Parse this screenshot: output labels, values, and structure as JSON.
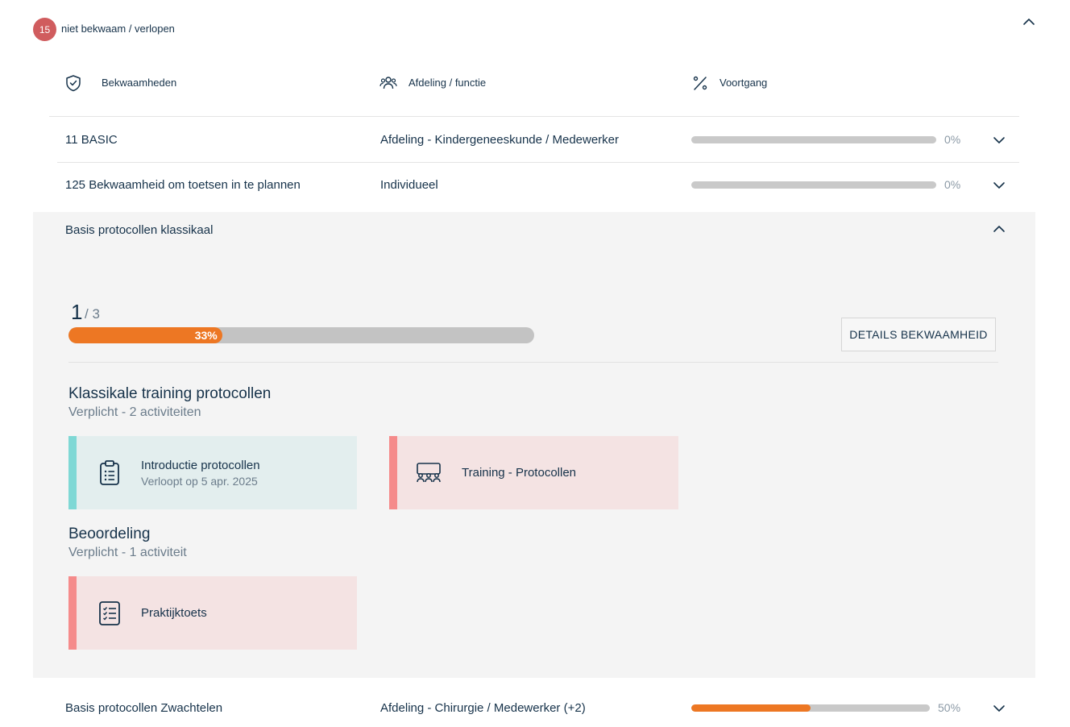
{
  "header": {
    "badge_count": "15",
    "badge_label": "niet bekwaam / verlopen"
  },
  "columns": {
    "competences": "Bekwaamheden",
    "department": "Afdeling / functie",
    "progress": "Voortgang"
  },
  "rows": [
    {
      "name": "11 BASIC",
      "department": "Afdeling - Kindergeneeskunde / Medewerker",
      "progress": 0,
      "progress_label": "0%"
    },
    {
      "name": "125 Bekwaamheid om toetsen in te plannen",
      "department": "Individueel",
      "progress": 0,
      "progress_label": "0%"
    },
    {
      "name": "Basis protocollen klassikaal"
    },
    {
      "name": "Basis protocollen Zwachtelen",
      "department": "Afdeling - Chirurgie / Medewerker (+2)",
      "progress": 50,
      "progress_label": "50%"
    }
  ],
  "expanded": {
    "done": "1",
    "total": "/ 3",
    "progress": 33,
    "progress_label": "33%",
    "details_button": "DETAILS BEKWAAMHEID",
    "sections": [
      {
        "title": "Klassikale training protocollen",
        "subtitle": "Verplicht - 2 activiteiten",
        "activities": [
          {
            "title": "Introductie protocollen",
            "subtitle": "Verloopt op 5 apr. 2025",
            "icon": "clipboard-icon",
            "status_color": "#7fd8d5"
          },
          {
            "title": "Training - Protocollen",
            "icon": "classroom-icon",
            "status_color": "#f58b8b"
          }
        ]
      },
      {
        "title": "Beoordeling",
        "subtitle": "Verplicht - 1 activiteit",
        "activities": [
          {
            "title": "Praktijktoets",
            "icon": "checklist-icon",
            "status_color": "#f58b8b"
          }
        ]
      }
    ]
  },
  "colors": {
    "accent": "#ed7723",
    "badge": "#d05c5e",
    "text": "#16324a",
    "track": "#c9c9c9"
  }
}
